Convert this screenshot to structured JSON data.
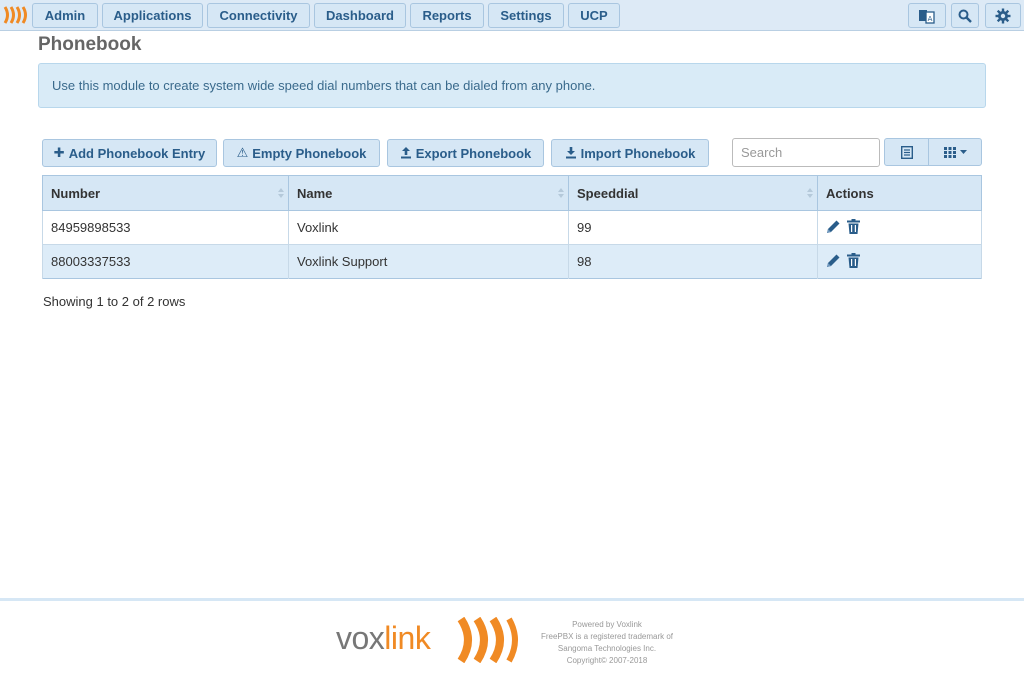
{
  "nav": {
    "items": [
      "Admin",
      "Applications",
      "Connectivity",
      "Dashboard",
      "Reports",
      "Settings",
      "UCP"
    ],
    "icons": [
      "language-icon",
      "search-icon",
      "gear-icon"
    ]
  },
  "page": {
    "title": "Phonebook",
    "info": "Use this module to create system wide speed dial numbers that can be dialed from any phone."
  },
  "toolbar": {
    "add_label": "Add Phonebook Entry",
    "empty_label": "Empty Phonebook",
    "export_label": "Export Phonebook",
    "import_label": "Import Phonebook",
    "search_placeholder": "Search"
  },
  "table": {
    "columns": [
      "Number",
      "Name",
      "Speeddial",
      "Actions"
    ],
    "rows": [
      {
        "number": "84959898533",
        "name": "Voxlink",
        "speeddial": "99"
      },
      {
        "number": "88003337533",
        "name": "Voxlink Support",
        "speeddial": "98"
      }
    ]
  },
  "status": "Showing 1 to 2 of 2 rows",
  "footer": {
    "brand_prefix": "vox",
    "brand_suffix": "link",
    "lines": [
      "Powered by Voxlink",
      "FreePBX is a registered trademark of",
      "Sangoma Technologies Inc.",
      "Copyright© 2007-2018"
    ]
  },
  "colors": {
    "accent": "#2a5d8a",
    "brand_orange": "#f08a24",
    "header_bg": "#d6e7f5"
  }
}
